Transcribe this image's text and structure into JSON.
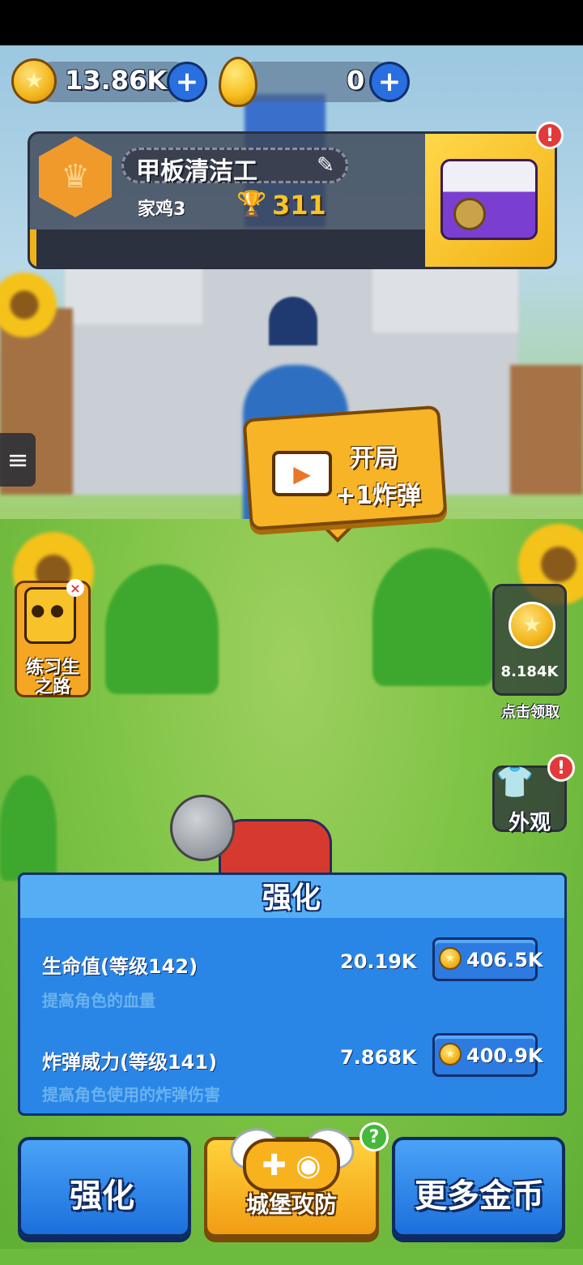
{
  "currency": {
    "gold_amount": "13.86K",
    "egg_amount": "0",
    "add_symbol": "+"
  },
  "profile": {
    "player_name": "甲板清洁工",
    "rank": "家鸡3",
    "trophies": "311",
    "alert_symbol": "!"
  },
  "menu": {
    "icon": "≡"
  },
  "promo": {
    "line1": "开局",
    "line2": "+1炸弹",
    "icon": "▶"
  },
  "trainee": {
    "label_line1": "练习生",
    "label_line2": "之路",
    "close_symbol": "×"
  },
  "claim": {
    "amount": "8.184K",
    "label": "点击领取"
  },
  "outfit": {
    "label": "外观",
    "alert_symbol": "!"
  },
  "upgrade": {
    "title": "强化",
    "rows": [
      {
        "name": "生命值(等级142)",
        "desc": "提高角色的血量",
        "value": "20.19K",
        "cost": "406.5K"
      },
      {
        "name": "炸弹威力(等级141)",
        "desc": "提高角色使用的炸弹伤害",
        "value": "7.868K",
        "cost": "400.9K"
      }
    ]
  },
  "nav": {
    "left": "强化",
    "center": "城堡攻防",
    "right": "更多金币",
    "help_symbol": "?"
  },
  "icons": {
    "coin": "coin-icon",
    "egg": "golden-egg-icon",
    "trophy": "trophy-icon",
    "edit": "pencil-icon",
    "chest": "treasure-chest-icon",
    "video": "video-icon",
    "gamepad": "gamepad-icon",
    "shirt": "shirt-icon"
  },
  "colors": {
    "accent_blue": "#2a86e6",
    "accent_gold": "#f6b426",
    "alert_red": "#e23a3a"
  }
}
